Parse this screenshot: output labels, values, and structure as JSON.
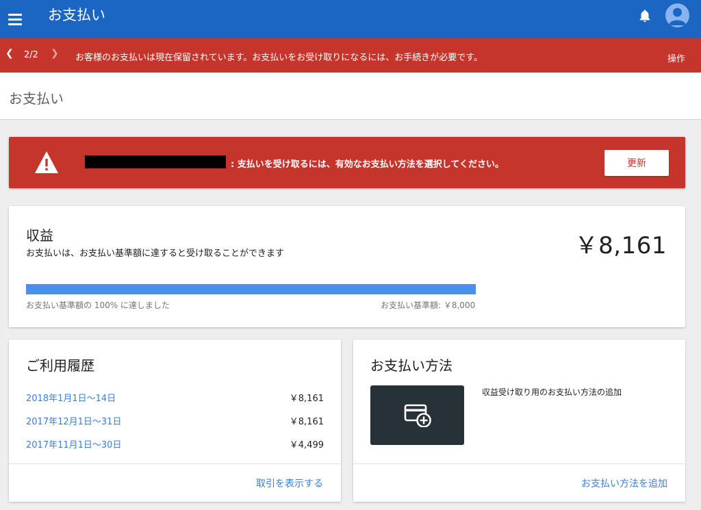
{
  "appbar": {
    "title": "お支払い",
    "icons": {
      "menu": "menu-icon",
      "notifications": "bell-icon",
      "account": "account-avatar-icon"
    }
  },
  "notice_bar": {
    "counter": "2/2",
    "prev_icon": "chevron-left-icon",
    "next_icon": "chevron-right-icon",
    "message": "お客様のお支払いは現在保留されています。お支払いをお受け取りになるには、お手続きが必要です。",
    "action_label": "操作",
    "color": "#c5352b"
  },
  "page": {
    "title": "お支払い"
  },
  "error_banner": {
    "icon": "warning-icon",
    "message": ": 支払いを受け取るには、有効なお支払い方法を選択してください。",
    "button_label": "更新"
  },
  "earnings": {
    "title": "収益",
    "subtitle": "お支払いは、お支払い基準額に達すると受け取ることができます",
    "amount": "￥8,161",
    "progress_percent": 100,
    "progress_label": "お支払い基準額の 100% に達しました",
    "threshold_label": "お支払い基準額: ￥8,000",
    "progress_color": "#4a8fef"
  },
  "history": {
    "title": "ご利用履歴",
    "rows": [
      {
        "period": "2018年1月1日〜14日",
        "amount": "￥8,161"
      },
      {
        "period": "2017年12月1日〜31日",
        "amount": "￥8,161"
      },
      {
        "period": "2017年11月1日〜30日",
        "amount": "￥4,499"
      }
    ],
    "footer_link": "取引を表示する"
  },
  "payment_methods": {
    "title": "お支払い方法",
    "tile_icon": "add-card-icon",
    "description": "収益受け取り用のお支払い方法の追加",
    "footer_link": "お支払い方法を追加"
  },
  "colors": {
    "appbar": "#1a66c2",
    "link": "#3a7fd8",
    "alert": "#c5352b"
  }
}
